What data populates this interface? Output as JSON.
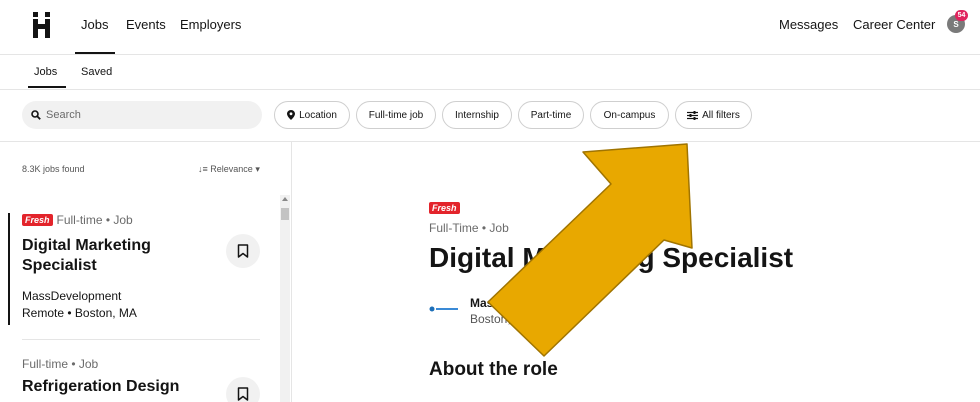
{
  "topnav": {
    "links": [
      "Jobs",
      "Events",
      "Employers"
    ],
    "messages": "Messages",
    "career_center": "Career Center",
    "avatar_initial": "S",
    "notification_count": "54"
  },
  "subnav": {
    "tabs": [
      "Jobs",
      "Saved"
    ]
  },
  "filters": {
    "search_placeholder": "Search",
    "chips": [
      "Location",
      "Full-time job",
      "Internship",
      "Part-time",
      "On-campus",
      "All filters"
    ]
  },
  "results": {
    "count": "8.3K jobs found",
    "sort": "Relevance",
    "jobs": [
      {
        "badge": "Fresh",
        "meta": "Full-time • Job",
        "title": "Digital Marketing Specialist",
        "company": "MassDevelopment",
        "location": "Remote • Boston, MA"
      },
      {
        "meta": "Full-time • Job",
        "title": "Refrigeration Design"
      }
    ]
  },
  "detail": {
    "badge": "Fresh",
    "meta": "Full-Time • Job",
    "title": "Digital Marketing Specialist",
    "company": "MassDevelopment",
    "location": "Boston, MA",
    "about_heading": "About the role"
  },
  "colors": {
    "fresh_red": "#e3242b",
    "annotation_arrow": "#e8a800",
    "notification": "#e0245e"
  }
}
